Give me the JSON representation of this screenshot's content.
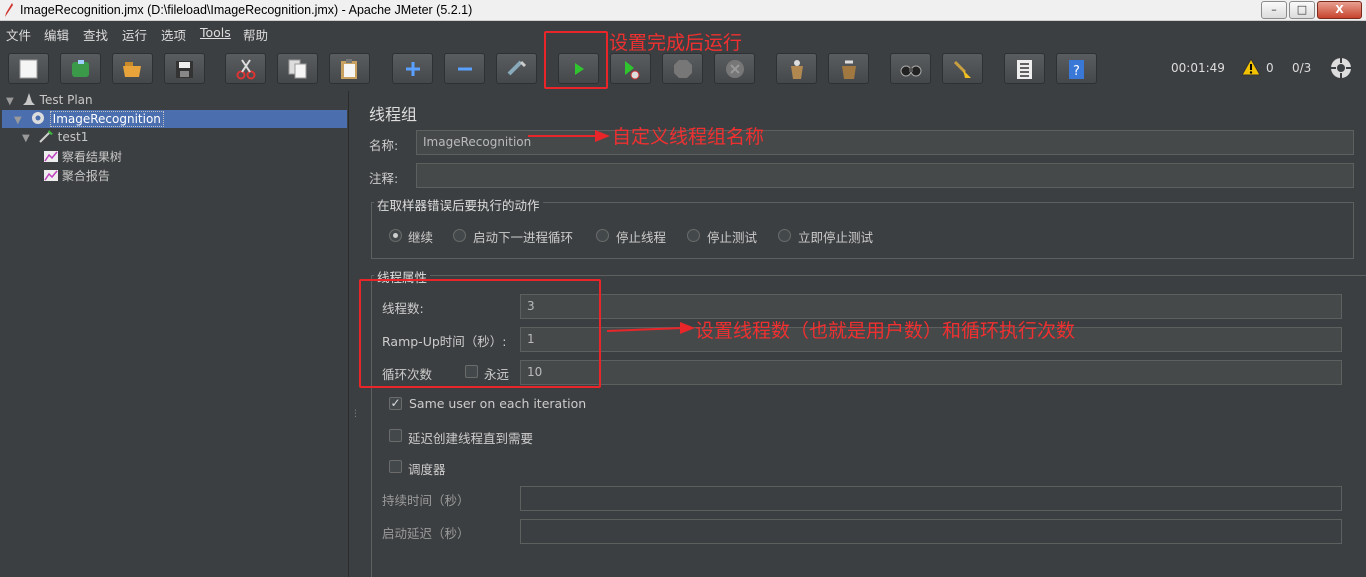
{
  "window": {
    "title": "ImageRecognition.jmx (D:\\fileload\\ImageRecognition.jmx) - Apache JMeter (5.2.1)",
    "minimize": "–",
    "maximize": "□",
    "close": "X"
  },
  "menu": [
    "文件",
    "编辑",
    "查找",
    "运行",
    "选项",
    "Tools",
    "帮助"
  ],
  "toolbar": {
    "buttons": [
      "new-icon",
      "templates-icon",
      "open-icon",
      "save-icon",
      "cut-icon",
      "copy-icon",
      "paste-icon",
      "expand-icon",
      "collapse-icon",
      "toggle-icon",
      "start-icon",
      "start-no-pause-icon",
      "stop-icon",
      "shutdown-icon",
      "clear-icon",
      "clear-all-icon",
      "search-icon",
      "reset-search-icon",
      "function-helper-icon",
      "help-icon"
    ],
    "elapsed": "00:01:49",
    "warnings": "0",
    "threads": "0/3"
  },
  "tree": {
    "root": "Test Plan",
    "thread_group": "ImageRecognition",
    "sampler": "test1",
    "listeners": [
      "察看结果树",
      "聚合报告"
    ]
  },
  "panel": {
    "title": "线程组",
    "name_label": "名称:",
    "name_value": "ImageRecognition",
    "comment_label": "注释:",
    "comment_value": "",
    "error_group_title": "在取样器错误后要执行的动作",
    "error_actions": [
      "继续",
      "启动下一进程循环",
      "停止线程",
      "停止测试",
      "立即停止测试"
    ],
    "error_selected": 0,
    "props_title": "线程属性",
    "threads_label": "线程数:",
    "threads_value": "3",
    "rampup_label": "Ramp-Up时间（秒）:",
    "rampup_value": "1",
    "loop_label": "循环次数",
    "forever_label": "永远",
    "forever_checked": false,
    "loop_value": "10",
    "same_user_label": "Same user on each iteration",
    "same_user_checked": true,
    "delay_label": "延迟创建线程直到需要",
    "delay_checked": false,
    "scheduler_label": "调度器",
    "scheduler_checked": false,
    "duration_label": "持续时间（秒）",
    "duration_value": "",
    "startup_delay_label": "启动延迟（秒）",
    "startup_delay_value": ""
  },
  "annotations": {
    "run": "设置完成后运行",
    "name": "自定义线程组名称",
    "threads": "设置线程数（也就是用户数）和循环执行次数"
  },
  "colors": {
    "background": "#3c3f41",
    "selection": "#4b6eaf",
    "annotation_red": "#e8262a"
  }
}
